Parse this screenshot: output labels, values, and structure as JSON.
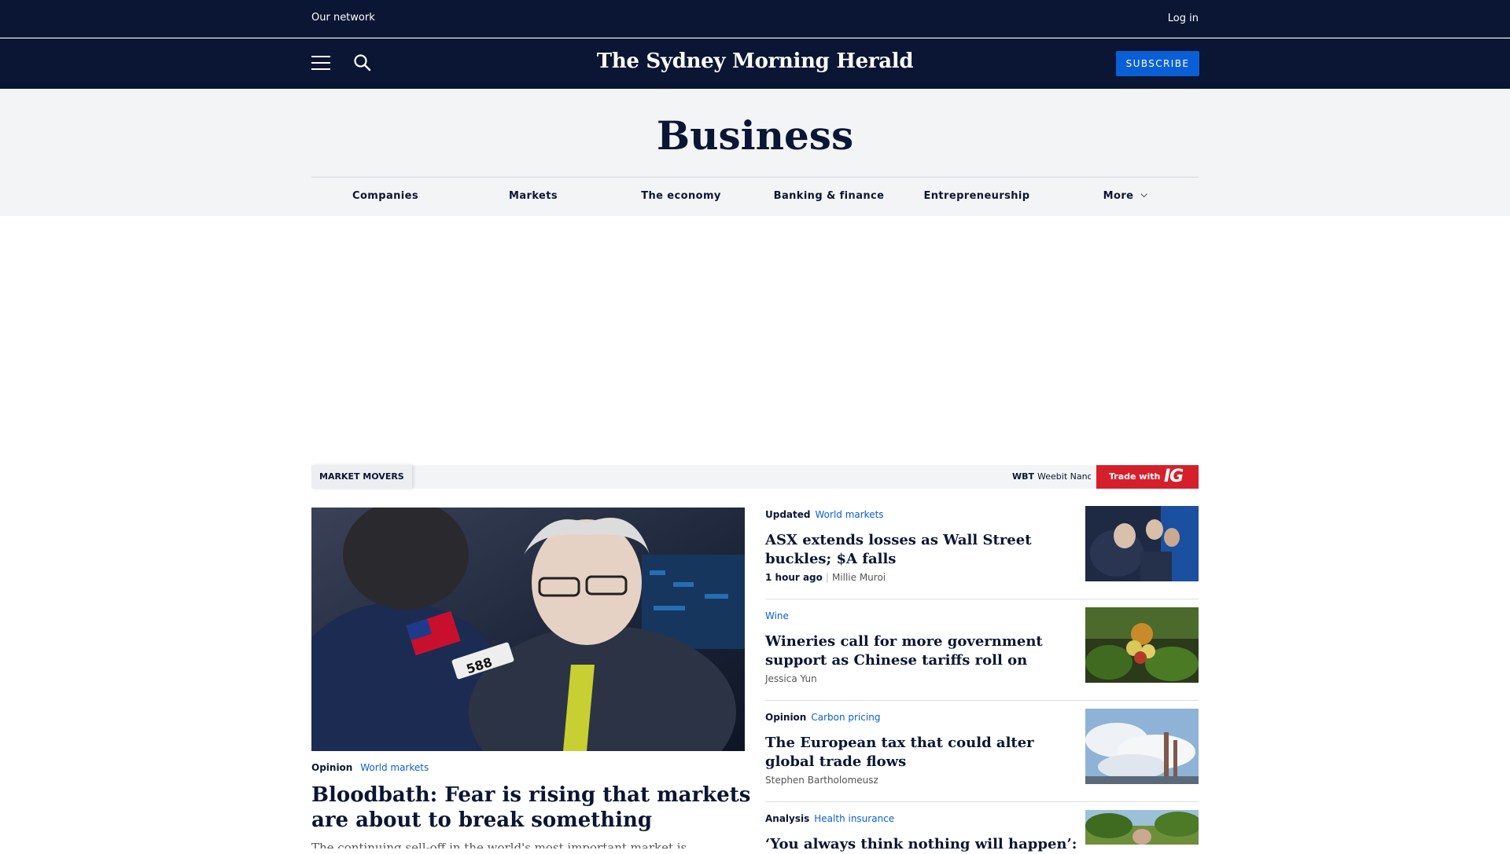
{
  "topbar": {
    "network": "Our network",
    "login": "Log in"
  },
  "masthead": {
    "logo": "The Sydney Morning Herald",
    "subscribe": "SUBSCRIBE"
  },
  "section": {
    "title": "Business",
    "nav": [
      "Companies",
      "Markets",
      "The economy",
      "Banking & finance",
      "Entrepreneurship",
      "More"
    ]
  },
  "market_movers": {
    "label": "MARKET MOVERS",
    "ticker_code": "WBT",
    "ticker_name": "Weebit Nano Ltd",
    "trade_with": "Trade with",
    "broker": "IG"
  },
  "lead": {
    "kicker": "Opinion",
    "tag": "World markets",
    "headline": "Bloodbath: Fear is rising that markets are about to break something",
    "summary": "The continuing sell-off in the world's most important market is increasing"
  },
  "stories": [
    {
      "kicker": "Updated",
      "tag": "World markets",
      "headline": "ASX extends losses as Wall Street buckles; $A falls",
      "time": "1 hour ago",
      "author": "Millie Muroi"
    },
    {
      "kicker": "",
      "tag": "Wine",
      "headline": "Wineries call for more government support as Chinese tariffs roll on",
      "time": "",
      "author": "Jessica Yun"
    },
    {
      "kicker": "Opinion",
      "tag": "Carbon pricing",
      "headline": "The European tax that could alter global trade flows",
      "time": "",
      "author": "Stephen Bartholomeusz"
    },
    {
      "kicker": "Analysis",
      "tag": "Health insurance",
      "headline": "‘You always think nothing will happen’:",
      "time": "",
      "author": ""
    }
  ],
  "colors": {
    "navy": "#0a1633",
    "link_blue": "#0a5fd6",
    "ig_red": "#d5202b"
  }
}
